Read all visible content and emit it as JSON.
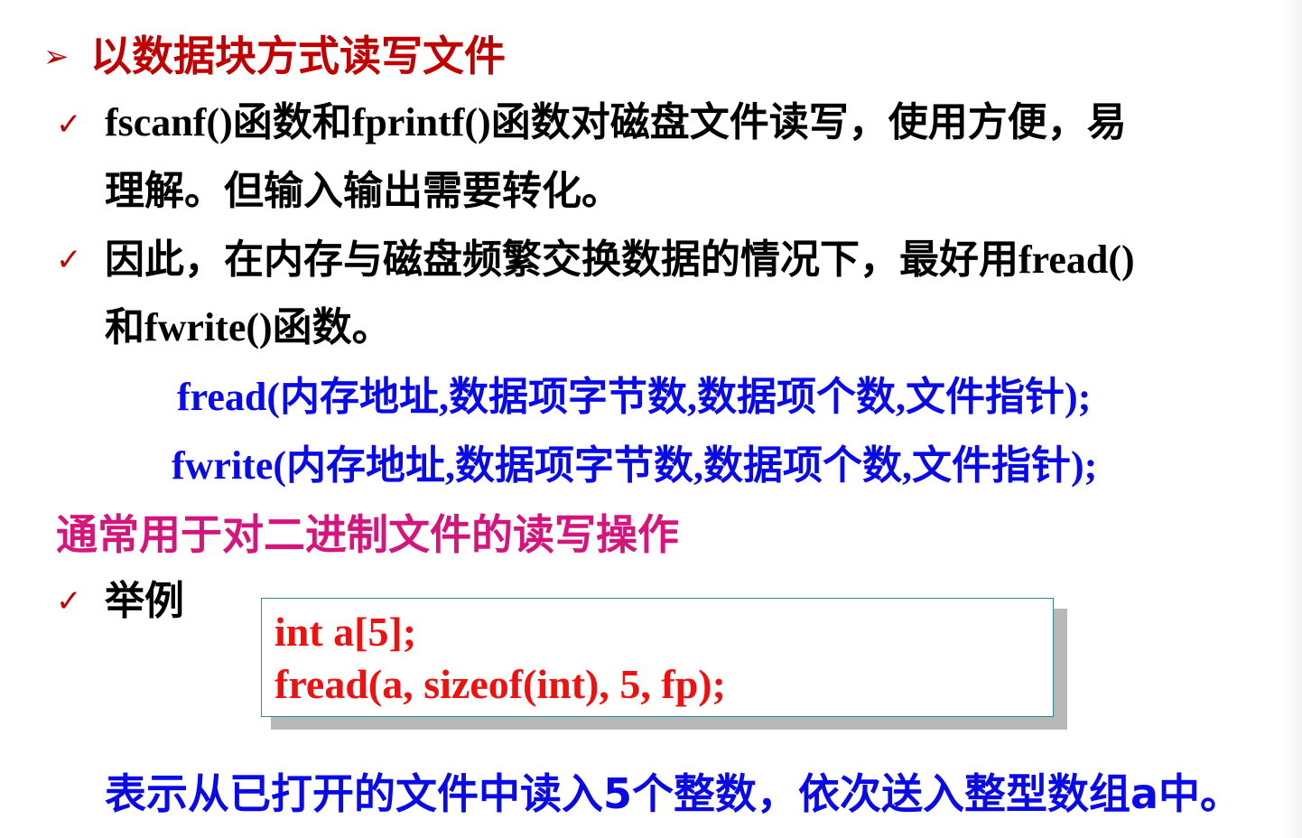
{
  "heading": {
    "marker": "➢",
    "text": "以数据块方式读写文件"
  },
  "bullets": {
    "check": "✓",
    "b1_line1": "fscanf()函数和fprintf()函数对磁盘文件读写，使用方便，易",
    "b1_line2": "理解。但输入输出需要转化。",
    "b2_line1": "因此，在内存与磁盘频繁交换数据的情况下，最好用fread()",
    "b2_line2": "和fwrite()函数。"
  },
  "prototypes": {
    "fread": "fread(内存地址,数据项字节数,数据项个数,文件指针);",
    "fwrite": "fwrite(内存地址,数据项字节数,数据项个数,文件指针);"
  },
  "note": "通常用于对二进制文件的读写操作",
  "example": {
    "label": "举例",
    "code_line1": "int a[5];",
    "code_line2": "fread(a, sizeof(int), 5, fp);"
  },
  "summary": "表示从已打开的文件中读入5个整数，依次送入整型数组a中。",
  "colors": {
    "heading": "#c00000",
    "prototype": "#0a0ae6",
    "note": "#d4157c",
    "code": "#ee1111",
    "body": "#000000"
  }
}
